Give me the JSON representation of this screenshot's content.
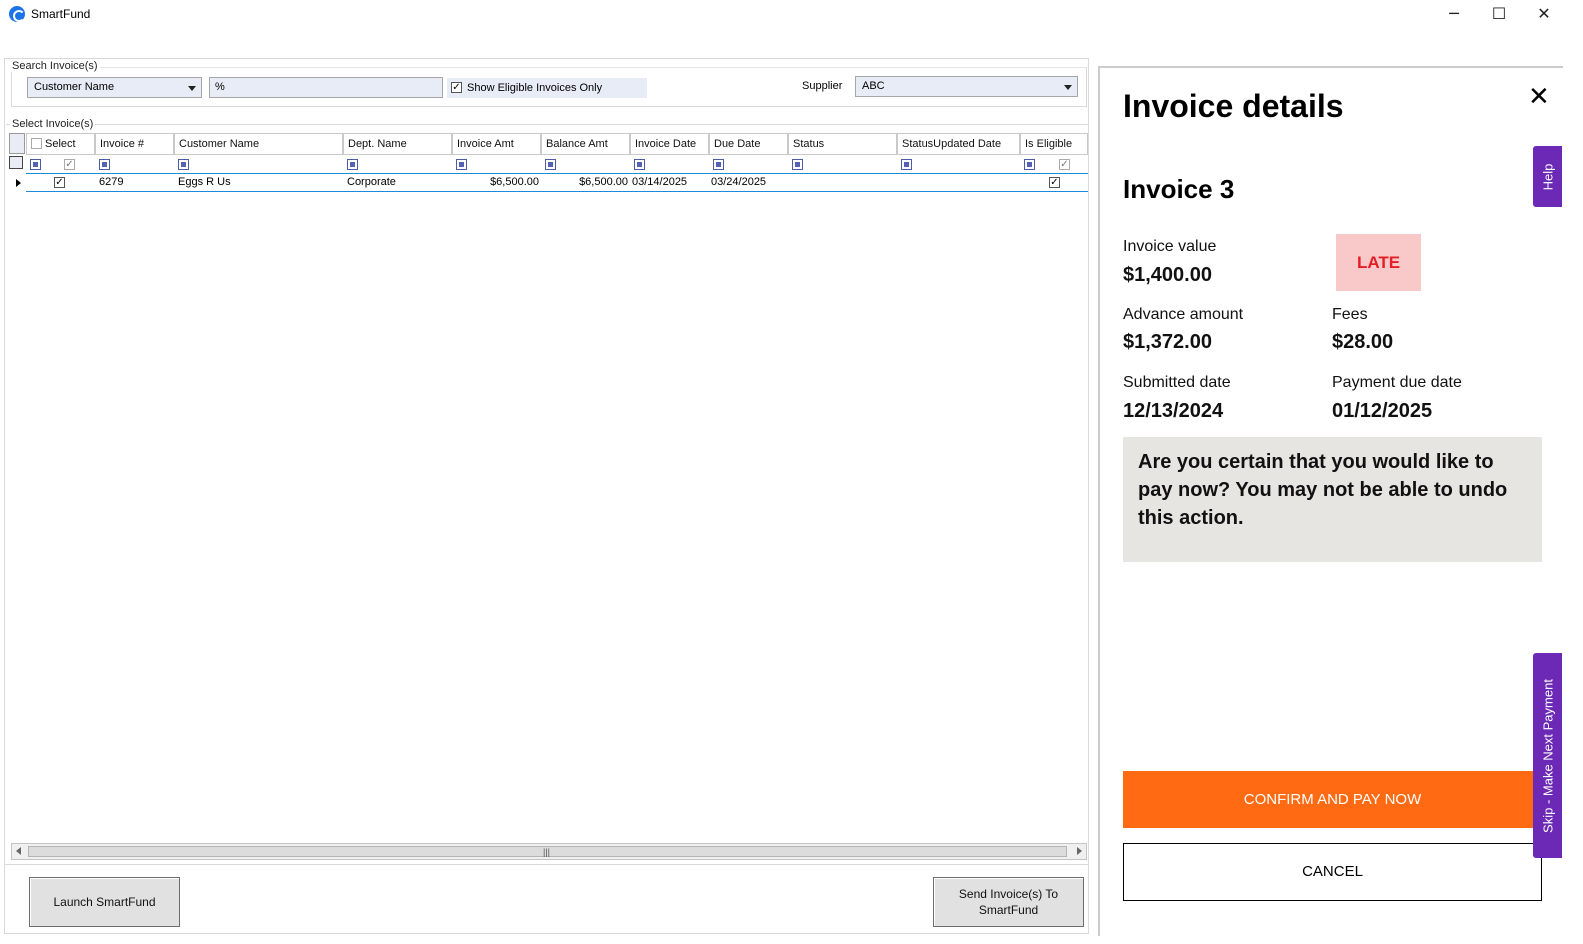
{
  "window": {
    "title": "SmartFund",
    "minimize_glyph": "─",
    "maximize_glyph": "☐",
    "close_glyph": "✕"
  },
  "search": {
    "group_label": "Search Invoice(s)",
    "field_combo": "Customer Name",
    "query_value": "%",
    "eligible_only_label": "Show Eligible Invoices Only",
    "eligible_only_checked": true,
    "supplier_label": "Supplier",
    "supplier_value": "ABC"
  },
  "grid": {
    "group_label": "Select Invoice(s)",
    "columns": [
      "Select",
      "Invoice #",
      "Customer Name",
      "Dept. Name",
      "Invoice Amt",
      "Balance Amt",
      "Invoice Date",
      "Due Date",
      "Status",
      "StatusUpdated Date",
      "Is Eligible"
    ],
    "rows": [
      {
        "selected": true,
        "invoice_no": "6279",
        "customer": "Eggs R Us",
        "dept": "Corporate",
        "invoice_amt": "$6,500.00",
        "balance_amt": "$6,500.00",
        "invoice_date": "03/14/2025",
        "due_date": "03/24/2025",
        "status": "",
        "status_updated": "",
        "is_eligible": true
      }
    ],
    "scroll_grip": "|||"
  },
  "buttons": {
    "launch": "Launch SmartFund",
    "send_line1": "Send Invoice(s) To",
    "send_line2": "SmartFund"
  },
  "panel": {
    "title": "Invoice details",
    "close_glyph": "✕",
    "invoice_name": "Invoice 3",
    "status_badge": "LATE",
    "invoice_value_label": "Invoice value",
    "invoice_value": "$1,400.00",
    "advance_label": "Advance amount",
    "advance_value": "$1,372.00",
    "fees_label": "Fees",
    "fees_value": "$28.00",
    "submitted_label": "Submitted date",
    "submitted_value": "12/13/2024",
    "due_label": "Payment due date",
    "due_value": "01/12/2025",
    "warning": "Are you certain that you would like to pay now? You may not be able to undo this action.",
    "confirm": "CONFIRM AND PAY NOW",
    "cancel": "CANCEL"
  },
  "side_tabs": {
    "help": "Help",
    "skip": "Skip - Make Next Payment"
  },
  "colors": {
    "accent_orange": "#ff6a13",
    "tab_purple": "#6b29b5",
    "late_bg": "#f9c9c9",
    "late_text": "#e31e24",
    "selection_blue": "#1b8ad8"
  }
}
